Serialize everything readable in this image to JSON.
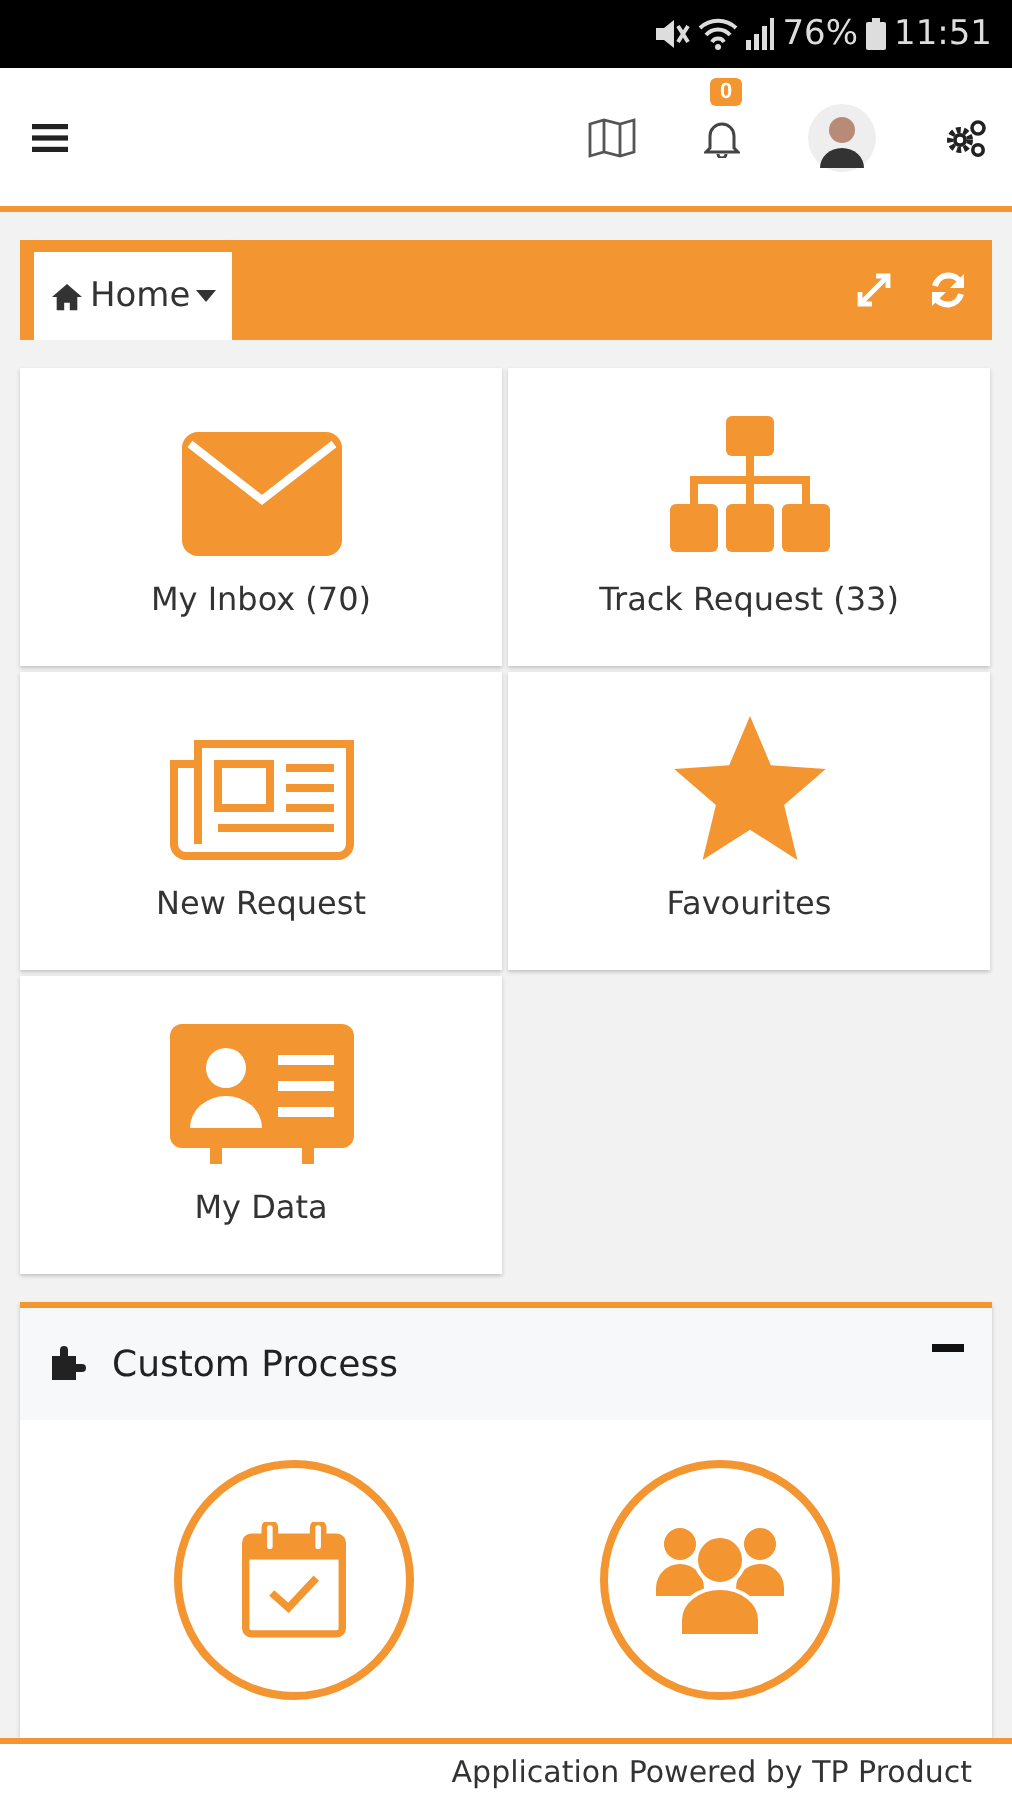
{
  "status_bar": {
    "battery": "76%",
    "time": "11:51"
  },
  "header": {
    "notification_count": "0"
  },
  "breadcrumb": {
    "label": "Home"
  },
  "tiles": [
    {
      "kind": "inbox",
      "label": "My Inbox (70)"
    },
    {
      "kind": "tree",
      "label": "Track Request (33)"
    },
    {
      "kind": "news",
      "label": "New Request"
    },
    {
      "kind": "star",
      "label": "Favourites"
    },
    {
      "kind": "contact",
      "label": "My Data"
    }
  ],
  "custom_process": {
    "title": "Custom Process",
    "expanded": true,
    "items": [
      {
        "kind": "calendar"
      },
      {
        "kind": "group"
      }
    ]
  },
  "footer": {
    "text": "Application Powered by TP Product"
  }
}
